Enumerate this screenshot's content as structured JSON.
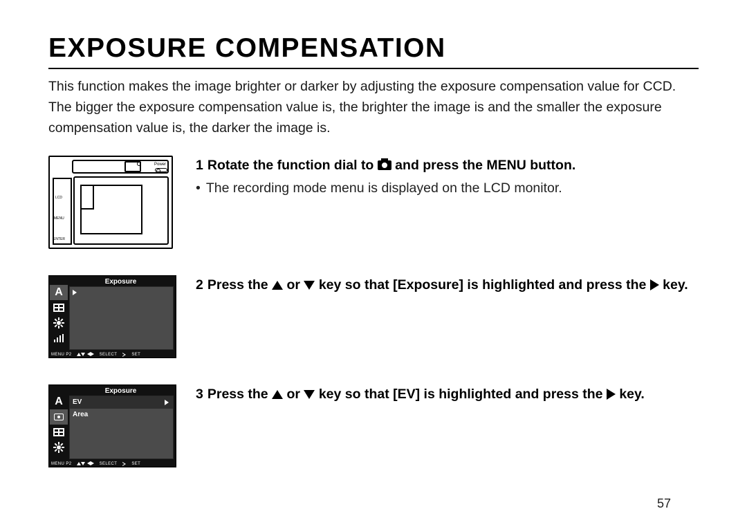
{
  "title": "EXPOSURE COMPENSATION",
  "intro": "This function makes the image brighter or darker  by adjusting the exposure compensation value for CCD. The bigger the exposure compensation value is, the brighter the image is and the smaller the exposure compensation value is, the darker the image is.",
  "steps": {
    "s1": {
      "num": "1",
      "head_a": "Rotate the function dial to ",
      "head_b": " and press the MENU button.",
      "bullet": "The recording mode menu is displayed on the LCD monitor."
    },
    "s2": {
      "num": "2",
      "head_a": "Press the ",
      "head_or": " or ",
      "head_b": " key so that [Exposure] is highlighted and press the ",
      "head_c": " key."
    },
    "s3": {
      "num": "3",
      "head_a": "Press the ",
      "head_or": " or ",
      "head_b": " key so that [EV] is highlighted and press the ",
      "head_c": " key."
    }
  },
  "fig1": {
    "power": "Power",
    "lcd": "LCD",
    "menu": "MENU",
    "enter": "ENTER"
  },
  "lcd": {
    "header": "Exposure",
    "footer_menu": "MENU P2",
    "footer_select": "SELECT",
    "footer_set": "SET",
    "rows": {
      "ev": "EV",
      "area": "Area"
    }
  },
  "page": "57"
}
